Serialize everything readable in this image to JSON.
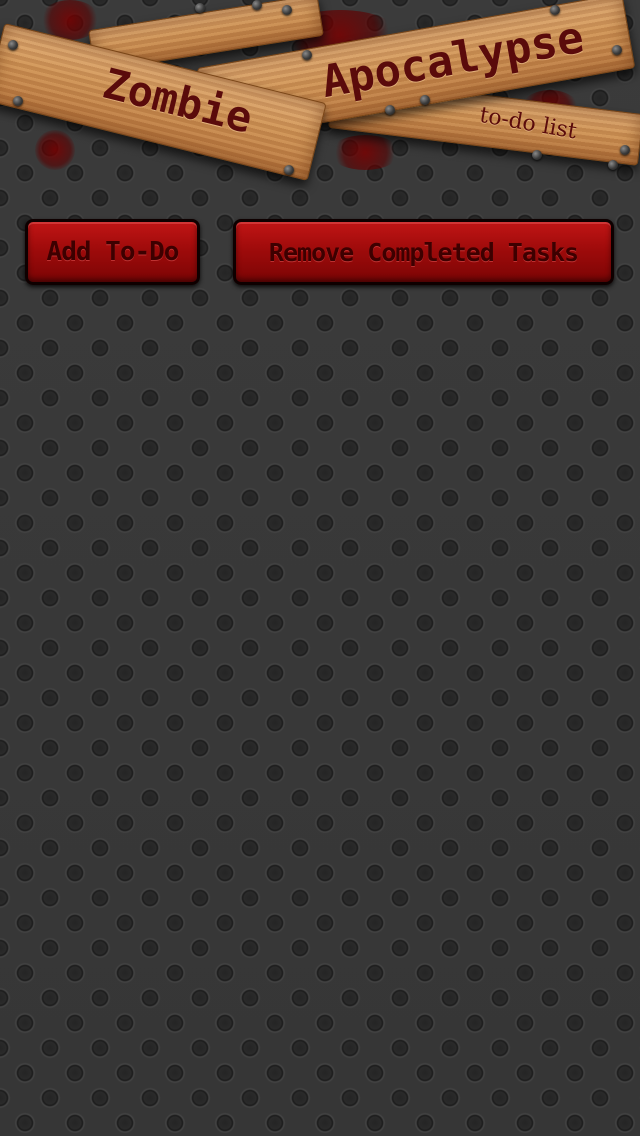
{
  "header": {
    "title_word_1": "Zombie",
    "title_word_2": "Apocalypse",
    "subtitle": "to-do list"
  },
  "toolbar": {
    "add_label": "Add To-Do",
    "remove_label": "Remove Completed Tasks"
  },
  "theme": {
    "button_red": "#a00b0b",
    "wood": "#cf9457",
    "background": "#3a3a3a",
    "text_dark_red": "#5a0b0b"
  }
}
